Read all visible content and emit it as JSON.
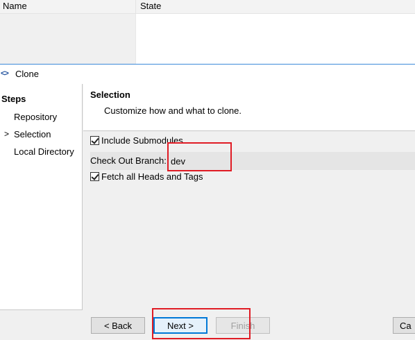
{
  "background_table": {
    "columns": [
      "Name",
      "State"
    ]
  },
  "dialog": {
    "title": "Clone",
    "title_icon": "<>",
    "steps": {
      "heading": "Steps",
      "items": [
        {
          "label": "Repository",
          "current": false
        },
        {
          "label": "Selection",
          "current": true
        },
        {
          "label": "Local Directory",
          "current": false
        }
      ],
      "current_marker": ">"
    },
    "page": {
      "title": "Selection",
      "description": "Customize how and what to clone."
    },
    "options": {
      "include_submodules": {
        "label": "Include Submodules",
        "checked": true
      },
      "checkout_branch": {
        "label": "Check Out Branch:",
        "value": "dev"
      },
      "fetch_heads_tags": {
        "label": "Fetch all Heads and Tags",
        "checked": true
      }
    },
    "buttons": {
      "back": "< Back",
      "next": "Next >",
      "finish": "Finish",
      "cancel": "Ca"
    }
  },
  "colors": {
    "highlight": "#e01b24",
    "focus_border": "#0078d7"
  }
}
